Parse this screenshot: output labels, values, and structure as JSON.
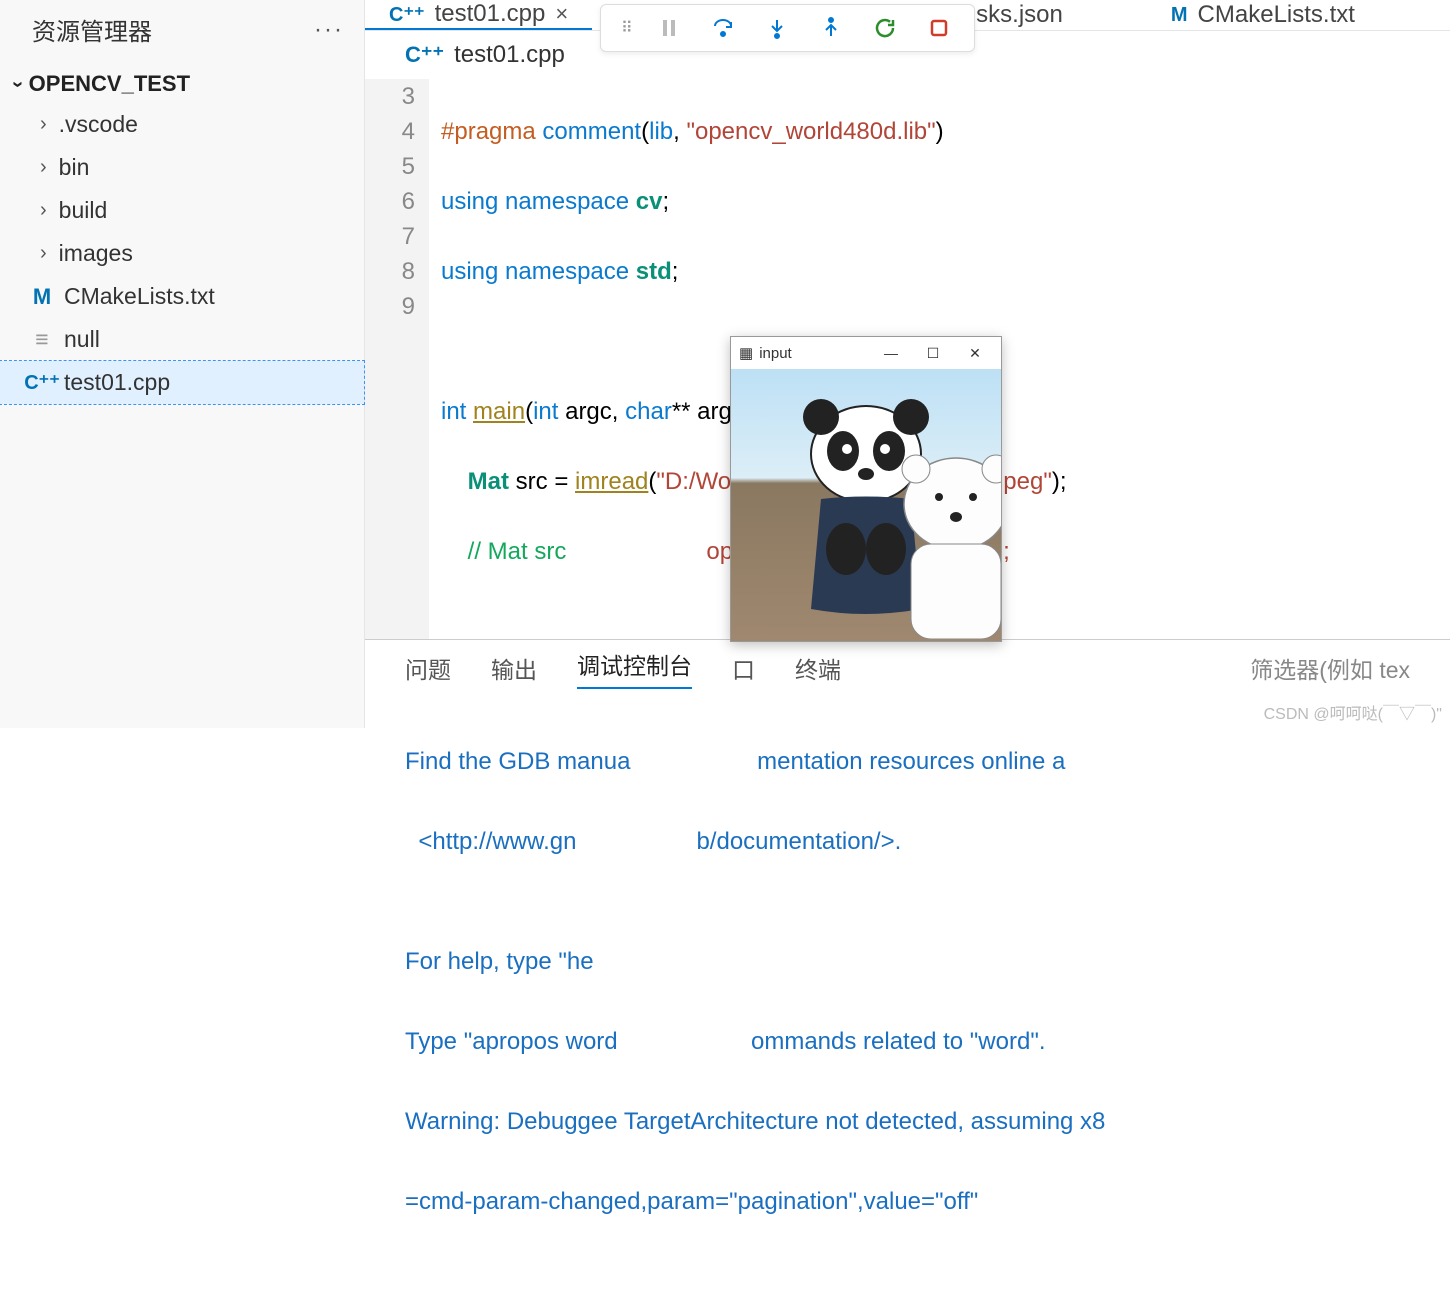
{
  "sidebar": {
    "title": "资源管理器",
    "more": "···",
    "project": "OPENCV_TEST",
    "items": [
      {
        "kind": "folder",
        "label": ".vscode"
      },
      {
        "kind": "folder",
        "label": "bin"
      },
      {
        "kind": "folder",
        "label": "build"
      },
      {
        "kind": "folder",
        "label": "images"
      },
      {
        "kind": "file",
        "label": "CMakeLists.txt",
        "icon": "cmake"
      },
      {
        "kind": "file",
        "label": "null",
        "icon": "null"
      },
      {
        "kind": "file",
        "label": "test01.cpp",
        "icon": "cpp",
        "selected": true
      }
    ]
  },
  "tabs": [
    {
      "label": "test01.cpp",
      "icon": "cpp",
      "active": true,
      "close": "×"
    },
    {
      "label": "sks.json",
      "icon": "",
      "active": false
    },
    {
      "label": "CMakeLists.txt",
      "icon": "cmake",
      "active": false
    }
  ],
  "breadcrumb": {
    "icon": "C⁺⁺",
    "file": "test01.cpp"
  },
  "lines": [
    "3",
    "4",
    "5",
    "6",
    "7",
    "8",
    "9"
  ],
  "code": {
    "l3a": "#pragma",
    "l3b": "comment",
    "l3c": "(",
    "l3d": "lib",
    "l3e": ", ",
    "l3f": "\"opencv_world480d.lib\"",
    "l3g": ")",
    "l4a": "using",
    "l4b": "namespace",
    "l4c": "cv",
    "l4d": ";",
    "l5a": "using",
    "l5b": "namespace",
    "l5c": "std",
    "l5d": ";",
    "l7a": "int",
    "l7b": "main",
    "l7c": "(",
    "l7d": "int",
    "l7e": " argc, ",
    "l7f": "char",
    "l7g": "** argv) {",
    "l8a": "    ",
    "l8b": "Mat",
    "l8c": " src = ",
    "l8d": "imread",
    "l8e": "(",
    "l8f": "\"D:/Work/opencv_test/images/1.jpeg\"",
    "l8g": ");",
    "l9a": "    ",
    "l9b": "// Mat src ",
    "l9c": "opencv_test/images/2.png\");"
  },
  "panel": {
    "tabs": [
      "问题",
      "输出",
      "调试控制台",
      "口",
      "终端"
    ],
    "activeIndex": 2,
    "filter": "筛选器(例如 tex",
    "lines": [
      "Find the GDB manua                   mentation resources online a",
      "  <http://www.gn                  b/documentation/>.",
      "",
      "For help, type \"he",
      "Type \"apropos word                    ommands related to \"word\".",
      "Warning: Debuggee TargetArchitecture not detected, assuming x8",
      "=cmd-param-changed,param=\"pagination\",value=\"off\""
    ]
  },
  "debugToolbar": {
    "buttons": [
      "grip",
      "pause",
      "step-over",
      "step-into",
      "step-out",
      "restart",
      "stop"
    ]
  },
  "imageWindow": {
    "title": "input",
    "minimize": "—",
    "maximize": "☐",
    "close": "✕"
  },
  "watermark": "CSDN @呵呵哒(￣▽￣)\""
}
